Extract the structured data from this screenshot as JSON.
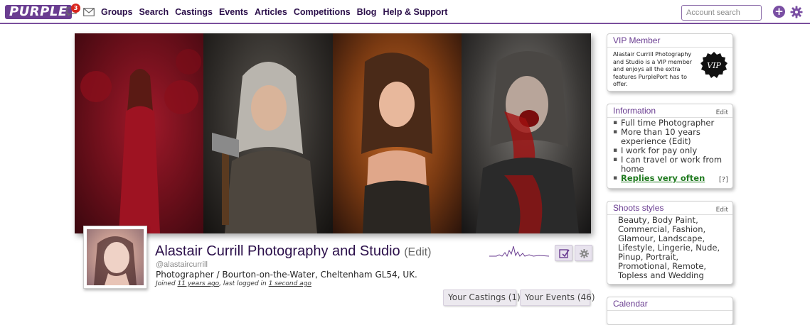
{
  "nav": {
    "logo": "PURPLE",
    "notification_count": "3",
    "links": [
      "Groups",
      "Search",
      "Castings",
      "Events",
      "Articles",
      "Competitions",
      "Blog",
      "Help & Support"
    ],
    "search_placeholder": "Account search"
  },
  "profile": {
    "name": "Alastair Currill Photography and Studio",
    "name_edit": "(Edit)",
    "handle": "@alastaircurrill",
    "location": "Photographer / Bourton-on-the-Water, Cheltenham GL54, UK.",
    "joined_prefix": "Joined",
    "joined_value": "11 years ago",
    "last_logged_prefix": ", last logged in",
    "last_logged_value": "1 second ago",
    "castings_button": "Your Castings (1)",
    "events_button": "Your Events (46)"
  },
  "vip": {
    "title": "VIP Member",
    "text": "Alastair Currill Photography and Studio is a VIP member and enjoys all the extra features PurplePort has to offer.",
    "badge": "VIP"
  },
  "information": {
    "title": "Information",
    "edit": "Edit",
    "items": [
      "Full time Photographer",
      "More than 10 years experience (Edit)",
      "I work for pay only",
      "I can travel or work from home"
    ],
    "replies": "Replies very often",
    "help": "[?]"
  },
  "shoots": {
    "title": "Shoots styles",
    "edit": "Edit",
    "styles": "Beauty, Body Paint, Commercial, Fashion, Glamour, Landscape, Lifestyle, Lingerie, Nude, Pinup, Portrait, Promotional, Remote, Topless and Wedding"
  },
  "calendar": {
    "title": "Calendar"
  },
  "colors": {
    "brand_purple": "#6a3d91",
    "nav_text": "#2b0f4a",
    "badge_red": "#d9251d",
    "replies_green": "#1f7a1f"
  },
  "icons": [
    "messages-icon",
    "mail-icon",
    "plus-icon",
    "gear-icon",
    "edit-profile-icon",
    "settings-icon",
    "vip-badge-icon",
    "activity-sparkline"
  ]
}
